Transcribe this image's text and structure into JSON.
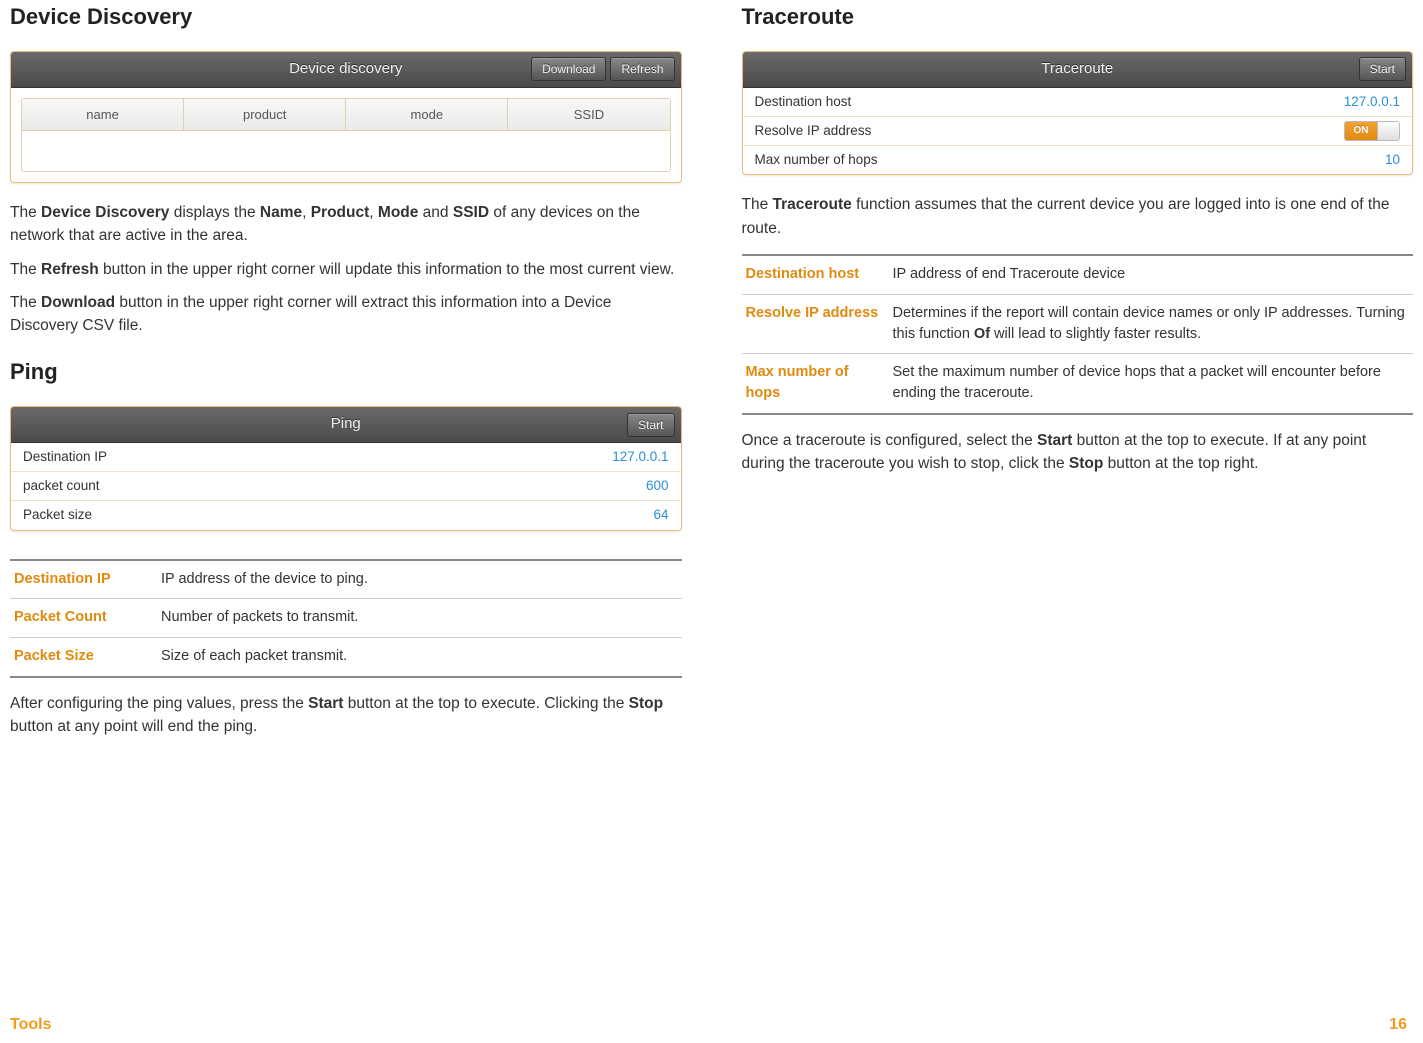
{
  "left": {
    "device_discovery": {
      "heading": "Device Discovery",
      "panel_title": "Device discovery",
      "download_btn": "Download",
      "refresh_btn": "Refresh",
      "columns": {
        "c1": "name",
        "c2": "product",
        "c3": "mode",
        "c4": "SSID"
      },
      "p1_a": "The ",
      "p1_b": "Device Discovery",
      "p1_c": " displays the ",
      "p1_d": "Name",
      "p1_e": ", ",
      "p1_f": "Product",
      "p1_g": ", ",
      "p1_h": "Mode",
      "p1_i": " and ",
      "p1_j": "SSID",
      "p1_k": " of any devices on the network that are active in the area.",
      "p2_a": "The ",
      "p2_b": "Refresh",
      "p2_c": " button in the upper right corner will update this information to the most current view.",
      "p3_a": "The ",
      "p3_b": "Download",
      "p3_c": " button in the upper right corner will extract this information into a Device Discovery CSV file."
    },
    "ping": {
      "heading": "Ping",
      "panel_title": "Ping",
      "start_btn": "Start",
      "rows": {
        "r1k": "Destination IP",
        "r1v": "127.0.0.1",
        "r2k": "packet count",
        "r2v": "600",
        "r3k": "Packet size",
        "r3v": "64"
      },
      "defs": {
        "d1t": "Destination IP",
        "d1d": "IP address of the device to ping.",
        "d2t": "Packet Count",
        "d2d": "Number of packets to transmit.",
        "d3t": "Packet Size",
        "d3d": "Size of each packet transmit."
      },
      "after_a": "After configuring the ping values, press the ",
      "after_b": "Start",
      "after_c": " button at the top to execute. Clicking the ",
      "after_d": "Stop",
      "after_e": " button at any point will end the ping."
    }
  },
  "right": {
    "traceroute": {
      "heading": "Traceroute",
      "panel_title": "Traceroute",
      "start_btn": "Start",
      "rows": {
        "r1k": "Destination host",
        "r1v": "127.0.0.1",
        "r2k": "Resolve IP address",
        "r2toggle": "ON",
        "r3k": "Max number of hops",
        "r3v": "10"
      },
      "p1_a": "The ",
      "p1_b": "Traceroute",
      "p1_c": " function assumes that the current device you are logged into is one end of the route.",
      "defs": {
        "d1t": "Destination host",
        "d1d": "IP address of end Traceroute device",
        "d2t": "Resolve IP address",
        "d2d_a": "Determines if the report will contain device names or only IP addresses. Turning this function ",
        "d2d_b": "Of",
        "d2d_c": " will lead to slightly faster results.",
        "d3t": "Max number of hops",
        "d3d": "Set the maximum number of device hops that a packet will encounter before ending the traceroute."
      },
      "after_a": "Once a traceroute is configured, select the ",
      "after_b": "Start",
      "after_c": " button at the top to execute. If at any point during the traceroute you wish to stop, click the ",
      "after_d": "Stop",
      "after_e": " button at the top right."
    }
  },
  "footer": {
    "left": "Tools",
    "right": "16"
  }
}
